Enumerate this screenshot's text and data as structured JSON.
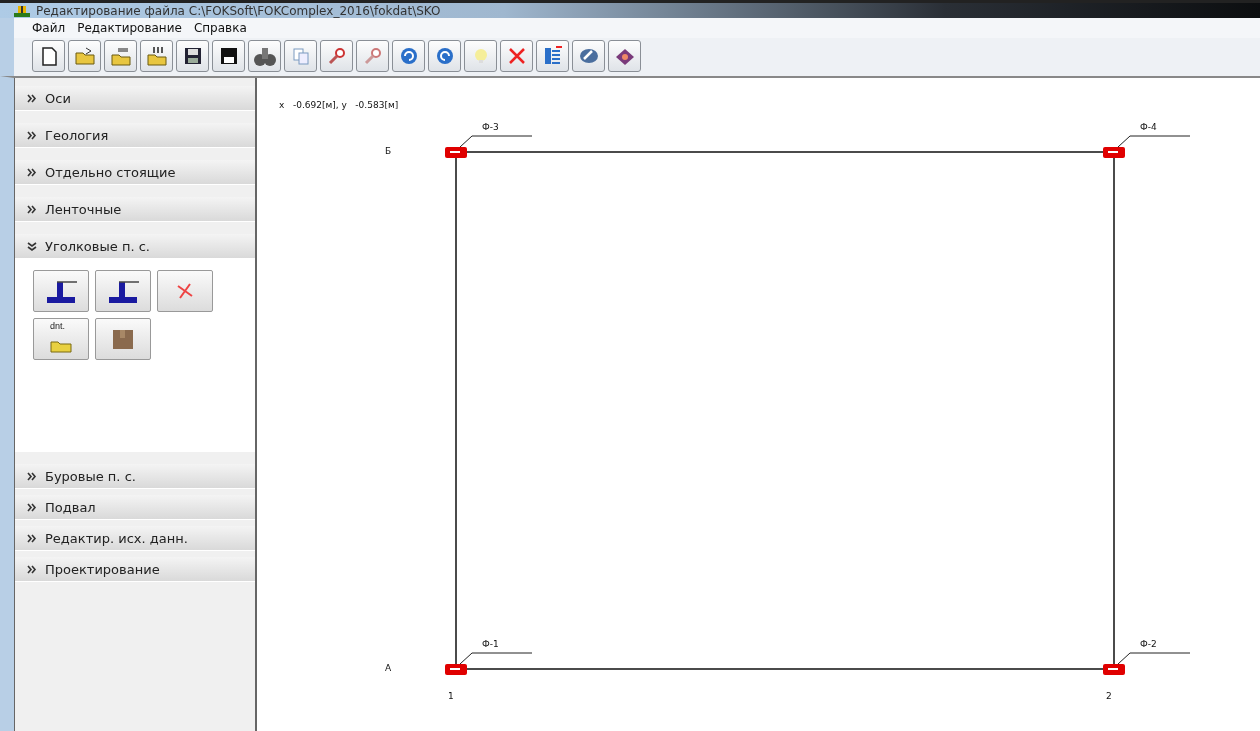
{
  "window": {
    "title": "Редактирование файла C:\\FOKSoft\\FOKComplex_2016\\fokdat\\SKO"
  },
  "menu": [
    "Файл",
    "Редактирование",
    "Справка"
  ],
  "sidebar": {
    "sections": [
      {
        "label": "Оси",
        "expanded": false
      },
      {
        "label": "Геология",
        "expanded": false
      },
      {
        "label": "Отдельно стоящие",
        "expanded": false
      },
      {
        "label": "Ленточные",
        "expanded": false
      },
      {
        "label": "Уголковые п. с.",
        "expanded": true,
        "tools": [
          {
            "kind": "wall"
          },
          {
            "kind": "wall"
          },
          {
            "kind": "delete"
          },
          {
            "kind": "open-file",
            "label": "dnt."
          },
          {
            "kind": "box"
          }
        ]
      },
      {
        "label": "Буровые п. с.",
        "expanded": false
      },
      {
        "label": "Подвал",
        "expanded": false
      },
      {
        "label": "Редактир. исх. данн.",
        "expanded": false
      },
      {
        "label": "Проектирование",
        "expanded": false
      }
    ]
  },
  "canvas": {
    "coordinates": "x   -0.692[м], y   -0.583[м]",
    "row_axes": [
      {
        "label": "Б"
      },
      {
        "label": "А"
      }
    ],
    "column_axes": [
      {
        "label": "1"
      },
      {
        "label": "2"
      }
    ],
    "foundations": [
      {
        "label": "Ф-3"
      },
      {
        "label": "Ф-4"
      },
      {
        "label": "Ф-1"
      },
      {
        "label": "Ф-2"
      }
    ]
  }
}
